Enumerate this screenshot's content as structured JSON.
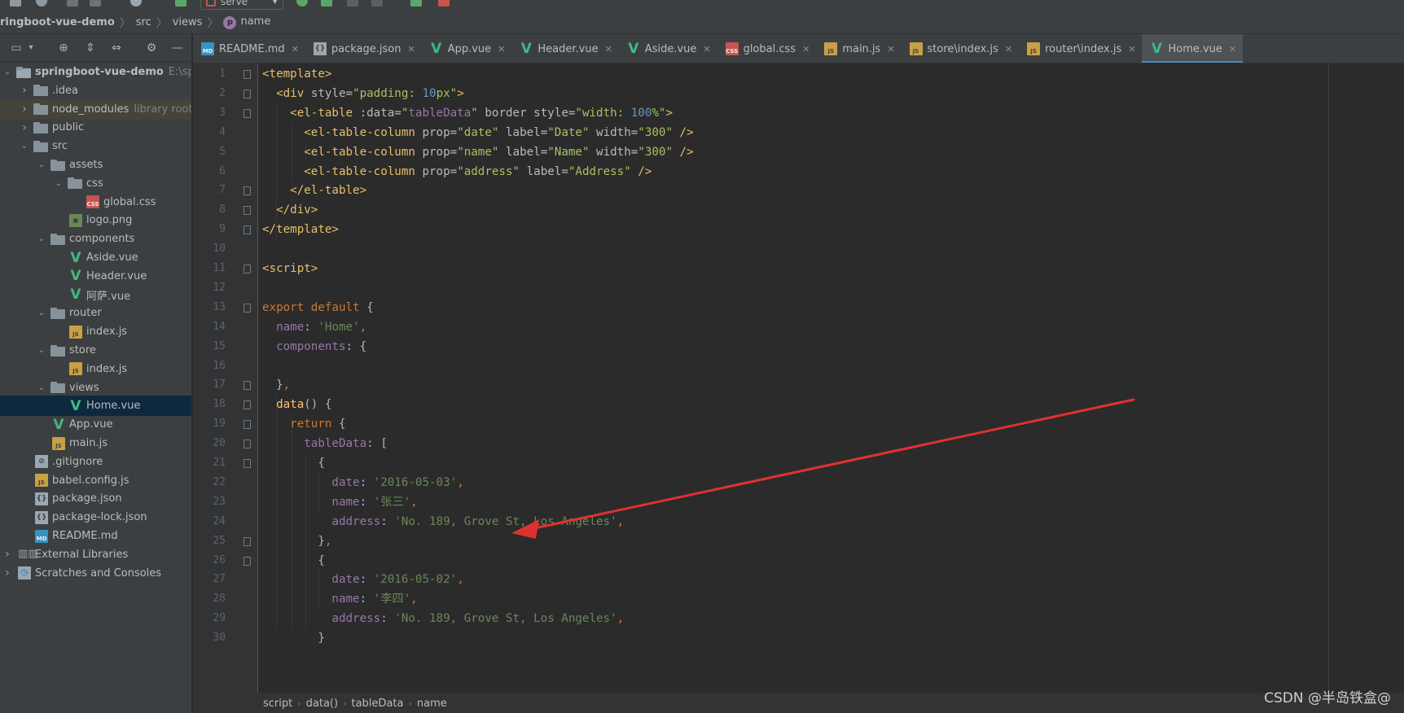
{
  "toolbar": {
    "run_config": "serve"
  },
  "navbar": {
    "crumbs": [
      "ringboot-vue-demo",
      "src",
      "views",
      "name"
    ]
  },
  "project": {
    "tree": [
      {
        "label": "springboot-vue-demo",
        "hint": "E:\\sp",
        "icon": "folder",
        "depth": 0,
        "expanded": true
      },
      {
        "label": ".idea",
        "icon": "folder",
        "depth": 1,
        "expanded": false
      },
      {
        "label": "node_modules",
        "hint": "library root",
        "icon": "folder",
        "depth": 1,
        "expanded": false
      },
      {
        "label": "public",
        "icon": "folder",
        "depth": 1,
        "expanded": false
      },
      {
        "label": "src",
        "icon": "folder",
        "depth": 1,
        "expanded": true
      },
      {
        "label": "assets",
        "icon": "folder",
        "depth": 2,
        "expanded": true
      },
      {
        "label": "css",
        "icon": "folder",
        "depth": 3,
        "expanded": true
      },
      {
        "label": "global.css",
        "icon": "css",
        "depth": 4
      },
      {
        "label": "logo.png",
        "icon": "png",
        "depth": 3
      },
      {
        "label": "components",
        "icon": "folder",
        "depth": 2,
        "expanded": true
      },
      {
        "label": "Aside.vue",
        "icon": "vue",
        "depth": 3
      },
      {
        "label": "Header.vue",
        "icon": "vue",
        "depth": 3
      },
      {
        "label": "阿萨.vue",
        "icon": "vue",
        "depth": 3
      },
      {
        "label": "router",
        "icon": "folder",
        "depth": 2,
        "expanded": true
      },
      {
        "label": "index.js",
        "icon": "js",
        "depth": 3
      },
      {
        "label": "store",
        "icon": "folder",
        "depth": 2,
        "expanded": true
      },
      {
        "label": "index.js",
        "icon": "js",
        "depth": 3
      },
      {
        "label": "views",
        "icon": "folder",
        "depth": 2,
        "expanded": true
      },
      {
        "label": "Home.vue",
        "icon": "vue",
        "depth": 3,
        "selected": true
      },
      {
        "label": "App.vue",
        "icon": "vue",
        "depth": 2
      },
      {
        "label": "main.js",
        "icon": "js",
        "depth": 2
      },
      {
        "label": ".gitignore",
        "icon": "git",
        "depth": 1
      },
      {
        "label": "babel.config.js",
        "icon": "js",
        "depth": 1
      },
      {
        "label": "package.json",
        "icon": "json",
        "depth": 1
      },
      {
        "label": "package-lock.json",
        "icon": "json",
        "depth": 1
      },
      {
        "label": "README.md",
        "icon": "md",
        "depth": 1
      },
      {
        "label": "External Libraries",
        "icon": "lib",
        "depth": 0,
        "expanded": false
      },
      {
        "label": "Scratches and Consoles",
        "icon": "scratch",
        "depth": 0,
        "expanded": false
      }
    ]
  },
  "tabs": [
    {
      "label": "README.md",
      "icon": "md"
    },
    {
      "label": "package.json",
      "icon": "json"
    },
    {
      "label": "App.vue",
      "icon": "vue"
    },
    {
      "label": "Header.vue",
      "icon": "vue"
    },
    {
      "label": "Aside.vue",
      "icon": "vue"
    },
    {
      "label": "global.css",
      "icon": "css"
    },
    {
      "label": "main.js",
      "icon": "js"
    },
    {
      "label": "store\\index.js",
      "icon": "js"
    },
    {
      "label": "router\\index.js",
      "icon": "js"
    },
    {
      "label": "Home.vue",
      "icon": "vue",
      "active": true
    }
  ],
  "editor": {
    "line_numbers": [
      "1",
      "2",
      "3",
      "4",
      "5",
      "6",
      "7",
      "8",
      "9",
      "10",
      "11",
      "12",
      "13",
      "14",
      "15",
      "16",
      "17",
      "18",
      "19",
      "20",
      "21",
      "22",
      "23",
      "24",
      "25",
      "26",
      "27",
      "28",
      "29",
      "30"
    ],
    "lines": [
      [
        [
          "t-tag",
          "<template>"
        ]
      ],
      [
        [
          "t-plain",
          "  "
        ],
        [
          "t-tag",
          "<div "
        ],
        [
          "t-attr",
          "style="
        ],
        [
          "t-str",
          "\"padding: "
        ],
        [
          "t-num",
          "10"
        ],
        [
          "t-str",
          "px\""
        ],
        [
          "t-tag",
          ">"
        ]
      ],
      [
        [
          "t-plain",
          "    "
        ],
        [
          "t-tag",
          "<el-table "
        ],
        [
          "t-attr",
          ":data="
        ],
        [
          "t-str",
          "\""
        ],
        [
          "t-prop",
          "tableData"
        ],
        [
          "t-str",
          "\" "
        ],
        [
          "t-attr",
          "border style="
        ],
        [
          "t-str",
          "\"width: "
        ],
        [
          "t-num",
          "100"
        ],
        [
          "t-str",
          "%\""
        ],
        [
          "t-tag",
          ">"
        ]
      ],
      [
        [
          "t-plain",
          "      "
        ],
        [
          "t-tag",
          "<el-table-column "
        ],
        [
          "t-attr",
          "prop="
        ],
        [
          "t-str",
          "\"date\" "
        ],
        [
          "t-attr",
          "label="
        ],
        [
          "t-str",
          "\"Date\" "
        ],
        [
          "t-attr",
          "width="
        ],
        [
          "t-str",
          "\"300\" "
        ],
        [
          "t-tag",
          "/>"
        ]
      ],
      [
        [
          "t-plain",
          "      "
        ],
        [
          "t-tag",
          "<el-table-column "
        ],
        [
          "t-attr",
          "prop="
        ],
        [
          "t-str",
          "\"name\" "
        ],
        [
          "t-attr",
          "label="
        ],
        [
          "t-str",
          "\"Name\" "
        ],
        [
          "t-attr",
          "width="
        ],
        [
          "t-str",
          "\"300\" "
        ],
        [
          "t-tag",
          "/>"
        ]
      ],
      [
        [
          "t-plain",
          "      "
        ],
        [
          "t-tag",
          "<el-table-column "
        ],
        [
          "t-attr",
          "prop="
        ],
        [
          "t-str",
          "\"address\" "
        ],
        [
          "t-attr",
          "label="
        ],
        [
          "t-str",
          "\"Address\" "
        ],
        [
          "t-tag",
          "/>"
        ]
      ],
      [
        [
          "t-plain",
          "    "
        ],
        [
          "t-tag",
          "</el-table>"
        ]
      ],
      [
        [
          "t-plain",
          "  "
        ],
        [
          "t-tag",
          "</div>"
        ]
      ],
      [
        [
          "t-tag",
          "</template>"
        ]
      ],
      [],
      [
        [
          "t-tag",
          "<script>"
        ]
      ],
      [],
      [
        [
          "t-kw",
          "export default "
        ],
        [
          "t-plain",
          "{"
        ]
      ],
      [
        [
          "t-plain",
          "  "
        ],
        [
          "t-prop",
          "name"
        ],
        [
          "t-plain",
          ": "
        ],
        [
          "t-sstr",
          "'Home'"
        ],
        [
          "t-kw",
          ","
        ]
      ],
      [
        [
          "t-plain",
          "  "
        ],
        [
          "t-prop",
          "components"
        ],
        [
          "t-plain",
          ": {"
        ]
      ],
      [],
      [
        [
          "t-plain",
          "  }"
        ],
        [
          "t-kw",
          ","
        ]
      ],
      [
        [
          "t-plain",
          "  "
        ],
        [
          "t-fn",
          "data"
        ],
        [
          "t-plain",
          "() {"
        ]
      ],
      [
        [
          "t-plain",
          "    "
        ],
        [
          "t-kw",
          "return "
        ],
        [
          "t-plain",
          "{"
        ]
      ],
      [
        [
          "t-plain",
          "      "
        ],
        [
          "t-prop",
          "tableData"
        ],
        [
          "t-plain",
          ": ["
        ]
      ],
      [
        [
          "t-plain",
          "        {"
        ]
      ],
      [
        [
          "t-plain",
          "          "
        ],
        [
          "t-prop",
          "date"
        ],
        [
          "t-plain",
          ": "
        ],
        [
          "t-sstr",
          "'2016-05-03'"
        ],
        [
          "t-kw",
          ","
        ]
      ],
      [
        [
          "t-plain",
          "          "
        ],
        [
          "t-prop",
          "name"
        ],
        [
          "t-plain",
          ": "
        ],
        [
          "t-sstr",
          "'张三'"
        ],
        [
          "t-kw",
          ","
        ]
      ],
      [
        [
          "t-plain",
          "          "
        ],
        [
          "t-prop",
          "address"
        ],
        [
          "t-plain",
          ": "
        ],
        [
          "t-sstr",
          "'No. 189, Grove St, Los Angeles'"
        ],
        [
          "t-kw",
          ","
        ]
      ],
      [
        [
          "t-plain",
          "        }"
        ],
        [
          "t-kw",
          ","
        ]
      ],
      [
        [
          "t-plain",
          "        {"
        ]
      ],
      [
        [
          "t-plain",
          "          "
        ],
        [
          "t-prop",
          "date"
        ],
        [
          "t-plain",
          ": "
        ],
        [
          "t-sstr",
          "'2016-05-02'"
        ],
        [
          "t-kw",
          ","
        ]
      ],
      [
        [
          "t-plain",
          "          "
        ],
        [
          "t-prop",
          "name"
        ],
        [
          "t-plain",
          ": "
        ],
        [
          "t-sstr",
          "'李四'"
        ],
        [
          "t-kw",
          ","
        ]
      ],
      [
        [
          "t-plain",
          "          "
        ],
        [
          "t-prop",
          "address"
        ],
        [
          "t-plain",
          ": "
        ],
        [
          "t-sstr",
          "'No. 189, Grove St, Los Angeles'"
        ],
        [
          "t-kw",
          ","
        ]
      ],
      [
        [
          "t-plain",
          "        }"
        ]
      ]
    ]
  },
  "breadcrumb": [
    "script",
    "data()",
    "tableData",
    "name"
  ],
  "watermark": "CSDN @半岛铁盒@",
  "colors": {
    "annotation_arrow": "#e03131",
    "accent": "#4a88c7"
  }
}
